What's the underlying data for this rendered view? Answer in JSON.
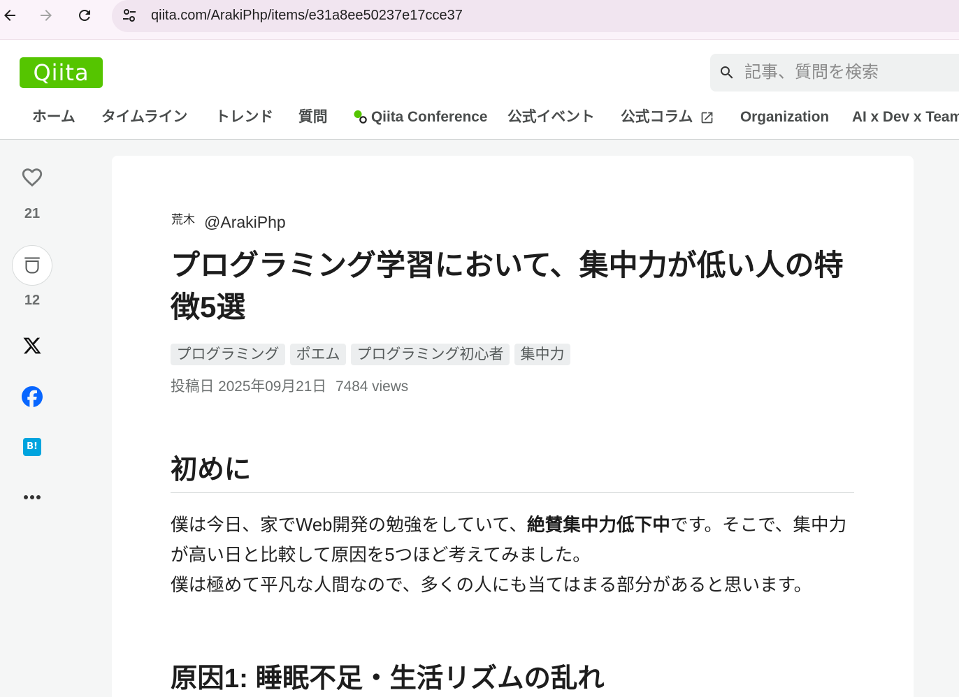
{
  "browser": {
    "url": "qiita.com/ArakiPhp/items/e31a8ee50237e17cce37",
    "icons": {
      "back": "arrow-left-icon",
      "forward": "arrow-right-icon",
      "reload": "reload-icon",
      "site_info": "tune-icon"
    },
    "forward_disabled": true
  },
  "header": {
    "logo_text": "Qiita",
    "search": {
      "placeholder": "記事、質問を検索",
      "icon": "search-icon"
    },
    "nav": [
      {
        "label": "ホーム"
      },
      {
        "label": "タイムライン"
      },
      {
        "label": "トレンド"
      },
      {
        "label": "質問"
      },
      {
        "label": "Qiita Conference",
        "icon": "qiita-conference-icon"
      },
      {
        "label": "公式イベント"
      },
      {
        "label": "公式コラム",
        "icon": "external-link-icon"
      },
      {
        "label": "Organization"
      },
      {
        "label": "AI x Dev x Team"
      }
    ]
  },
  "sidebar": {
    "like": {
      "icon": "heart-icon",
      "count": "21"
    },
    "stock": {
      "icon": "stock-icon",
      "count": "12"
    },
    "share": [
      {
        "icon": "x-logo-icon"
      },
      {
        "icon": "facebook-icon"
      },
      {
        "icon": "hatena-bookmark-icon",
        "label": "B!"
      }
    ],
    "more": {
      "icon": "more-dots-icon"
    }
  },
  "article": {
    "author": {
      "avatar_text": "荒木",
      "handle": "@ArakiPhp"
    },
    "title": "プログラミング学習において、集中力が低い人の特徴5選",
    "tags": [
      "プログラミング",
      "ポエム",
      "プログラミング初心者",
      "集中力"
    ],
    "meta": {
      "posted": "投稿日 2025年09月21日",
      "views": "7484 views"
    },
    "sections": [
      {
        "heading": "初めに",
        "paragraph": {
          "before": "僕は今日、家でWeb開発の勉強をしていて、",
          "bold": "絶賛集中力低下中",
          "after": "です。そこで、集中力が高い日と比較して原因を5つほど考えてみました。",
          "after_break": "僕は極めて平凡な人間なので、多くの人にも当てはまる部分があると思います。"
        }
      },
      {
        "heading": "原因1: 睡眠不足・生活リズムの乱れ"
      }
    ]
  },
  "colors": {
    "brand_green": "#55c500",
    "page_background": "#f5f6f6",
    "card_background": "#ffffff",
    "tag_background": "#eceeef",
    "facebook_blue": "#0866ff",
    "hatena_blue": "#00a4de"
  }
}
